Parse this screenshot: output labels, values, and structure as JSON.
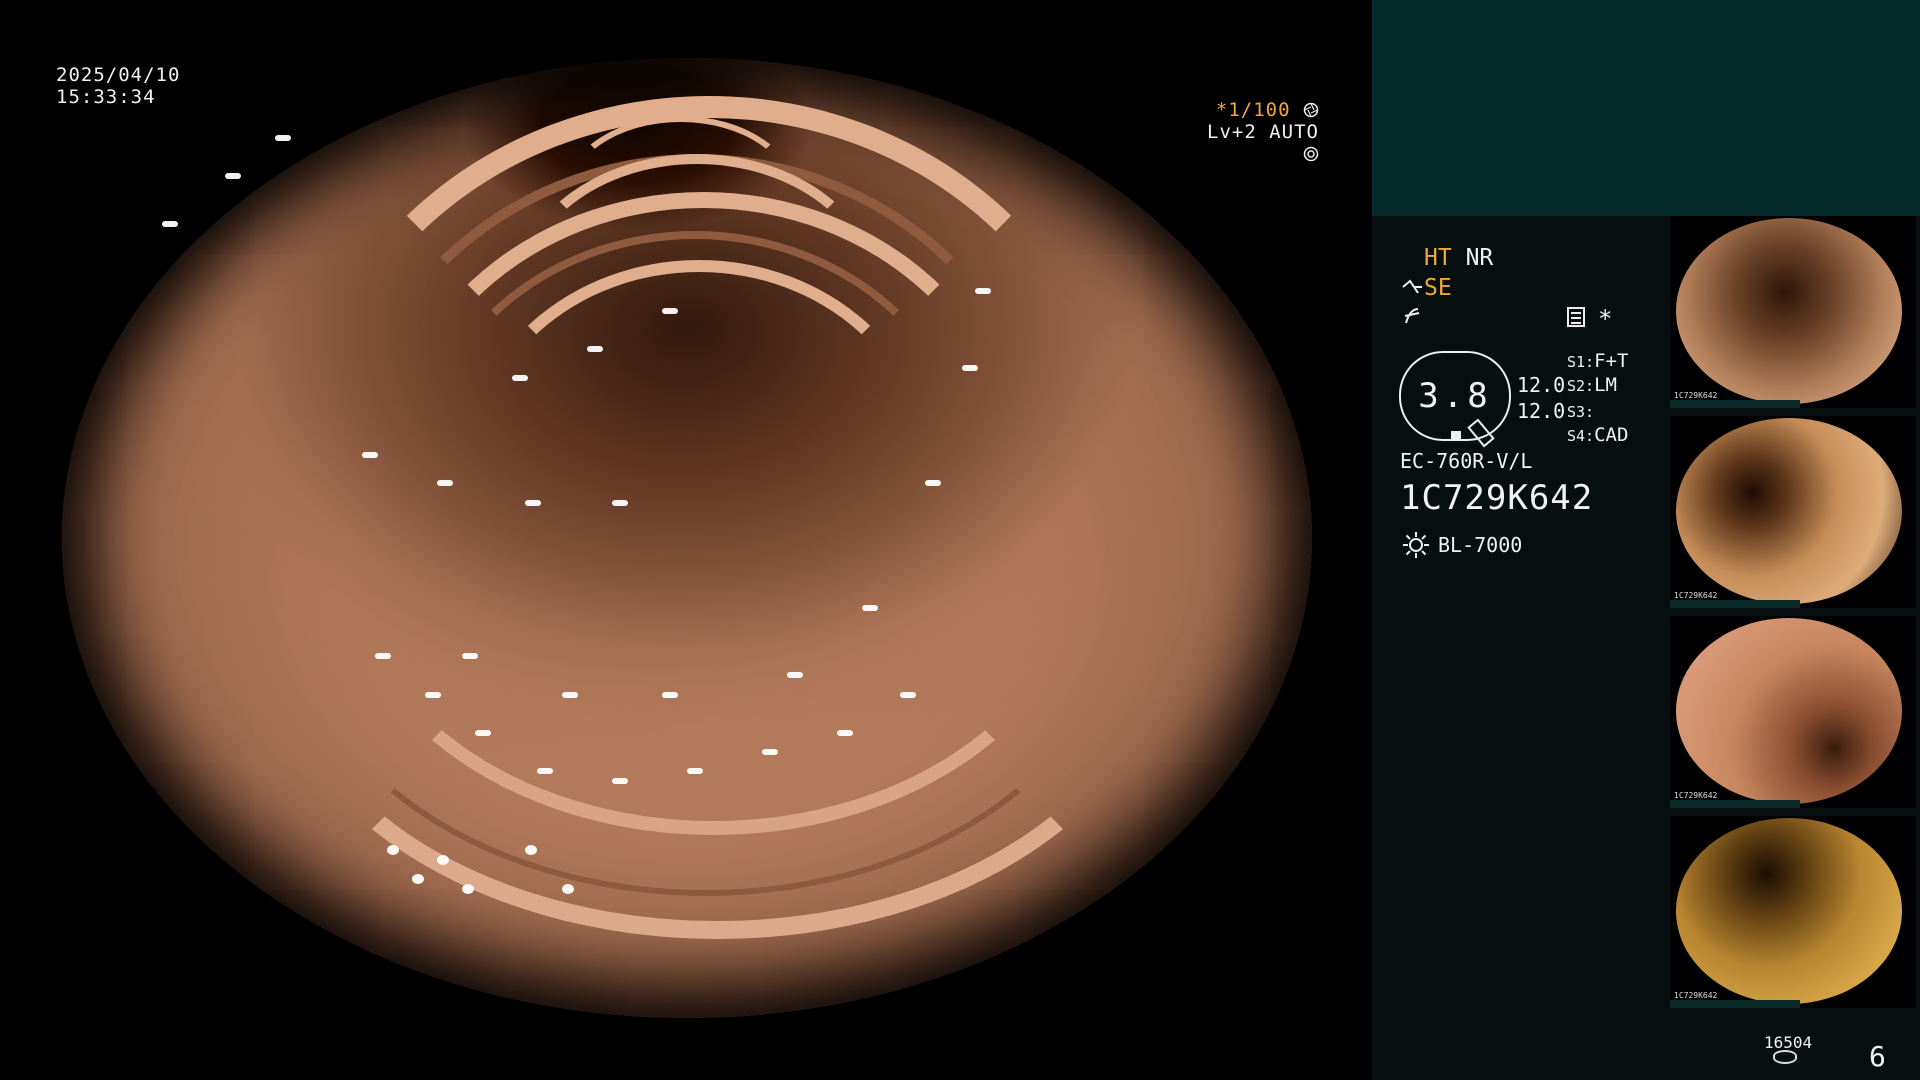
{
  "overlay": {
    "date": "2025/04/10",
    "time": "15:33:34",
    "shutter_prefix": "*",
    "shutter_value": "1/100",
    "shutter_icon": "aperture-icon",
    "level_value": "Lv+2 AUTO",
    "level_icon": "iris-icon"
  },
  "panel": {
    "ht_label": "HT",
    "nr_label": "NR",
    "se_label": "SE",
    "se_icon": "scope-tip-icon",
    "f_icon": "f-symbol-icon",
    "menu_icon": "document-icon",
    "star_label": "*",
    "zoom_value": "3.8",
    "value_1": "12.0",
    "value_2": "12.0",
    "switches": [
      {
        "key": "S1:",
        "value": "F+T"
      },
      {
        "key": "S2:",
        "value": "LM"
      },
      {
        "key": "S3:",
        "value": ""
      },
      {
        "key": "S4:",
        "value": "CAD"
      }
    ],
    "scope_model": "EC-760R-V/L",
    "scope_serial": "1C729K642",
    "light_icon": "sun-icon",
    "light_source": "BL-7000",
    "storage_count": "16504",
    "storage_icon": "disk-icon",
    "page_number": "6",
    "thumbnails": [
      {
        "caption": "1C729K642",
        "tone": "#b07c58"
      },
      {
        "caption": "1C729K642",
        "tone": "#c48c58"
      },
      {
        "caption": "1C729K642",
        "tone": "#c7865f"
      },
      {
        "caption": "1C729K642",
        "tone": "#b88530"
      }
    ]
  }
}
